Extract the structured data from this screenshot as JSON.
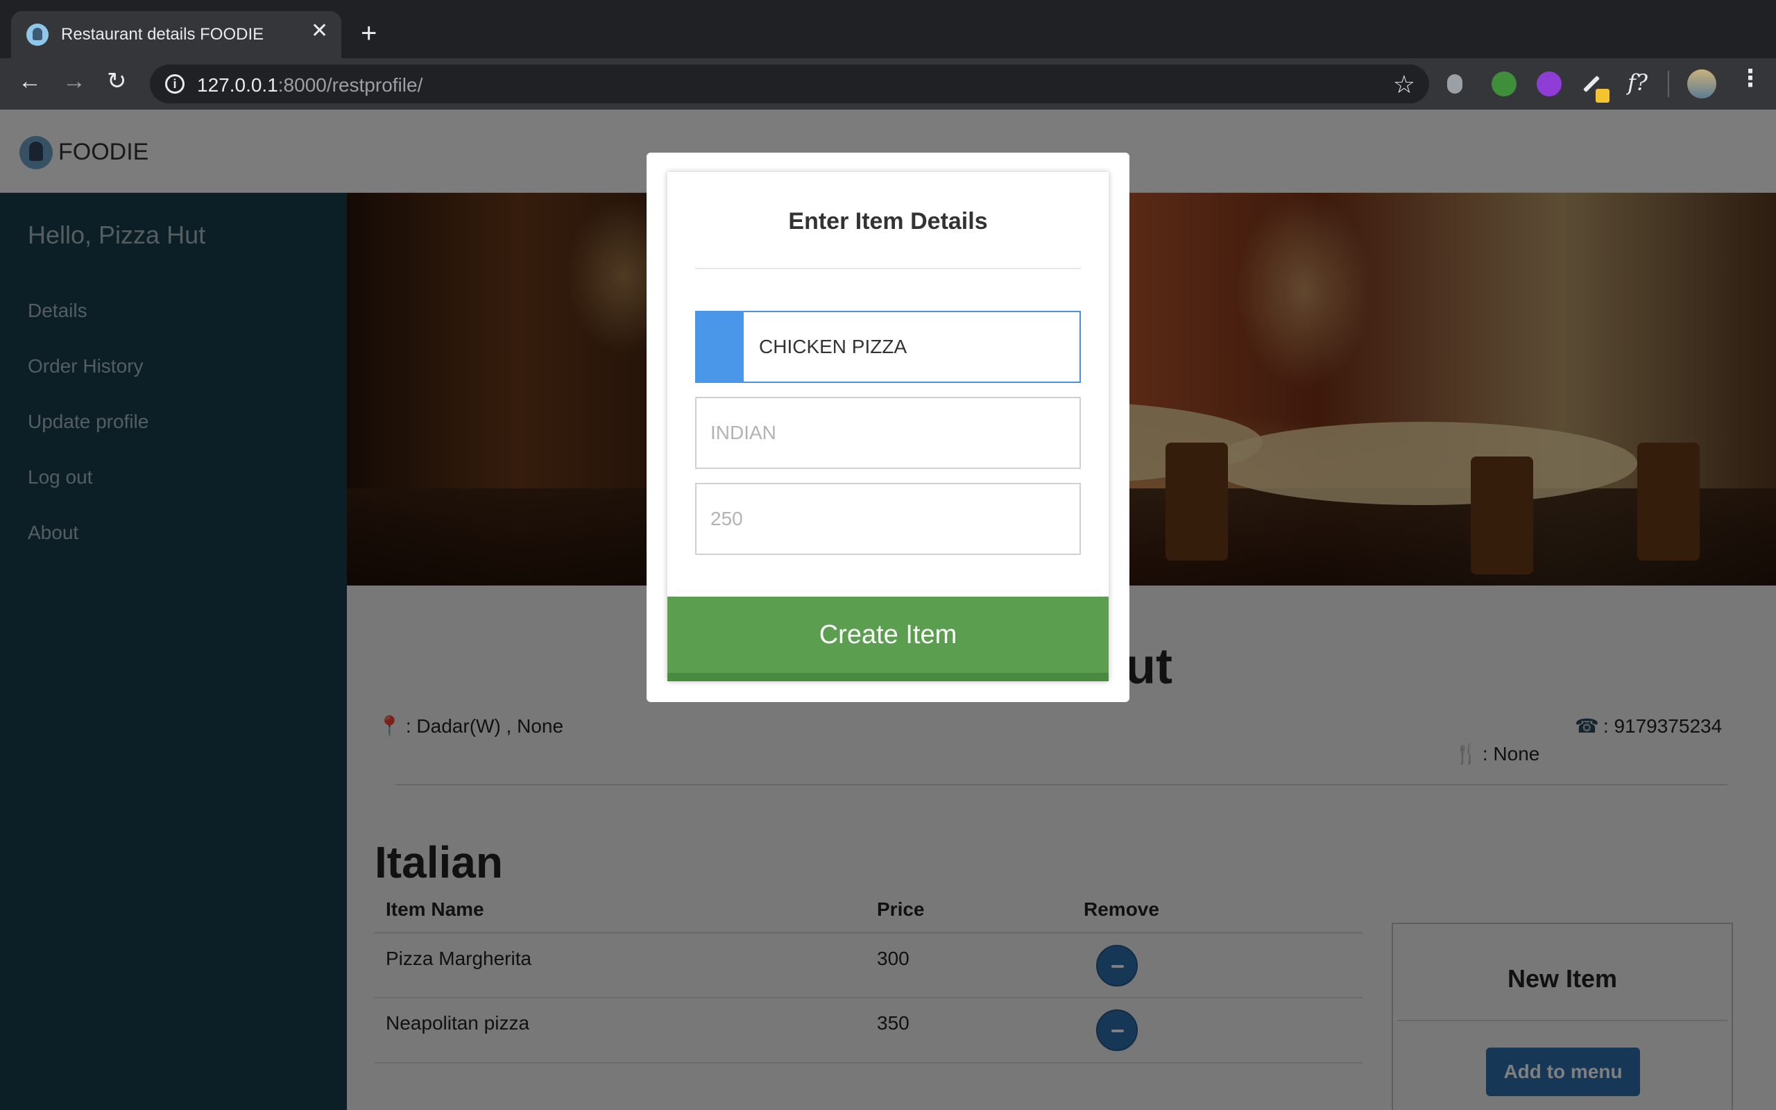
{
  "browser": {
    "tab_title": "Restaurant details FOODIE",
    "url_host": "127.0.0.1",
    "url_rest": ":8000/restprofile/",
    "extensions": [
      "extension-gray-icon",
      "extension-tree-icon",
      "extension-purple-icon",
      "extension-pencil-icon",
      "extension-fx-icon"
    ],
    "ext_fx_label": "f?"
  },
  "site": {
    "brand": "FOODIE"
  },
  "sidebar": {
    "greeting": "Hello, Pizza Hut",
    "items": [
      {
        "label": "Details"
      },
      {
        "label": "Order History"
      },
      {
        "label": "Update profile"
      },
      {
        "label": "Log out"
      },
      {
        "label": "About"
      }
    ]
  },
  "restaurant": {
    "name": "Pizza Hut",
    "address": ": Dadar(W) , None",
    "phone": ": 9179375234",
    "cuisine": ": None"
  },
  "menu": {
    "section_title": "Italian",
    "headers": {
      "name": "Item Name",
      "price": "Price",
      "remove": "Remove"
    },
    "rows": [
      {
        "name": "Pizza Margherita",
        "price": "300"
      },
      {
        "name": "Neapolitan pizza",
        "price": "350"
      }
    ]
  },
  "new_item": {
    "title": "New Item",
    "button": "Add to menu"
  },
  "modal": {
    "title": "Enter Item Details",
    "item_name_value": "CHICKEN PIZZA",
    "cuisine_placeholder": "INDIAN",
    "price_placeholder": "250",
    "submit_label": "Create Item"
  },
  "colors": {
    "sidebar": "#1a3e4c",
    "primary_button": "#2f6fad",
    "create_button": "#5c9e50",
    "input_focus": "#4a90e2"
  }
}
